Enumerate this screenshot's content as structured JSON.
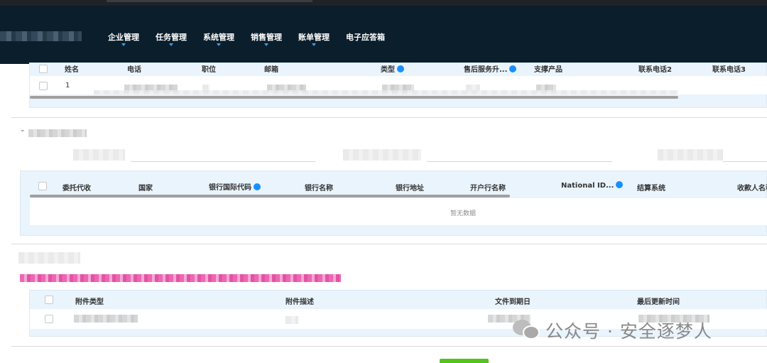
{
  "nav": {
    "menu": [
      {
        "label": "企业管理",
        "has_dropdown": true
      },
      {
        "label": "任务管理",
        "has_dropdown": true
      },
      {
        "label": "系统管理",
        "has_dropdown": true
      },
      {
        "label": "销售管理",
        "has_dropdown": true
      },
      {
        "label": "账单管理",
        "has_dropdown": true
      },
      {
        "label": "电子应答箱",
        "has_dropdown": false
      }
    ]
  },
  "contacts_table": {
    "columns": [
      "姓名",
      "电话",
      "职位",
      "邮箱",
      "类型",
      "售后服务升...",
      "支撑产品",
      "联系电话2",
      "联系电话3"
    ],
    "columns_with_info_icon": [
      "类型",
      "售后服务升..."
    ],
    "rows": [
      {
        "index": "1"
      }
    ]
  },
  "bank_table": {
    "columns": [
      "委托代收",
      "国家",
      "银行国际代码",
      "银行名称",
      "银行地址",
      "开户行名称",
      "National ID...",
      "结算系统",
      "收款人名称"
    ],
    "columns_with_info_icon": [
      "银行国际代码",
      "National ID..."
    ],
    "empty_text": "暂无数据"
  },
  "attachments_table": {
    "columns": [
      "附件类型",
      "附件描述",
      "文件到期日",
      "最后更新时间"
    ]
  },
  "watermark": {
    "text": "公众号 · 安全逐梦人",
    "icon": "wechat-icon"
  },
  "colors": {
    "nav_bg": "#0b1e2c",
    "accent": "#1890ff",
    "panel_bg": "#e9f4fd",
    "warning": "#e8339a",
    "primary_button": "#52c41a"
  }
}
